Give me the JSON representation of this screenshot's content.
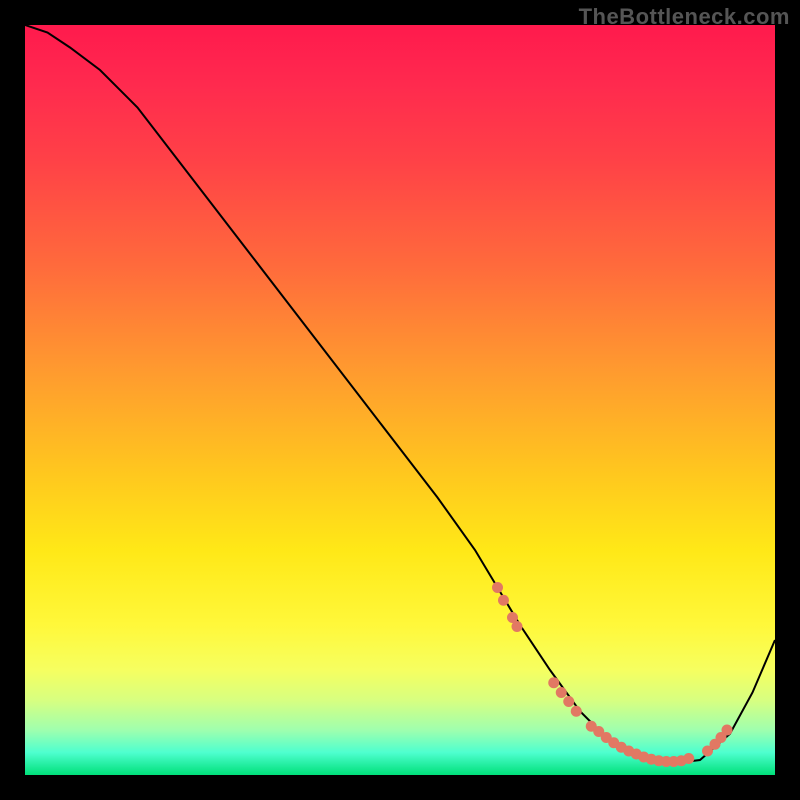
{
  "watermark": "TheBottleneck.com",
  "chart_data": {
    "type": "line",
    "title": "",
    "xlabel": "",
    "ylabel": "",
    "xlim": [
      0,
      100
    ],
    "ylim": [
      0,
      100
    ],
    "grid": false,
    "legend": false,
    "series": [
      {
        "name": "bottleneck-curve",
        "x": [
          0,
          3,
          6,
          10,
          15,
          20,
          25,
          30,
          35,
          40,
          45,
          50,
          55,
          60,
          63,
          66,
          70,
          74,
          78,
          82,
          86,
          90,
          94,
          97,
          100
        ],
        "y": [
          100,
          99,
          97,
          94,
          89,
          82.5,
          76,
          69.5,
          63,
          56.5,
          50,
          43.5,
          37,
          30,
          25,
          20,
          14,
          8.5,
          4.5,
          2.2,
          1.5,
          2.0,
          5.5,
          11,
          18
        ],
        "stroke": "#000000",
        "stroke_width": 2
      }
    ],
    "markers": {
      "name": "trough-markers",
      "color": "#e27863",
      "points": [
        {
          "x": 63.0,
          "y": 25.0
        },
        {
          "x": 63.8,
          "y": 23.3
        },
        {
          "x": 65.0,
          "y": 21.0
        },
        {
          "x": 65.6,
          "y": 19.8
        },
        {
          "x": 70.5,
          "y": 12.3
        },
        {
          "x": 71.5,
          "y": 11.0
        },
        {
          "x": 72.5,
          "y": 9.8
        },
        {
          "x": 73.5,
          "y": 8.5
        },
        {
          "x": 75.5,
          "y": 6.5
        },
        {
          "x": 76.5,
          "y": 5.8
        },
        {
          "x": 77.5,
          "y": 5.0
        },
        {
          "x": 78.5,
          "y": 4.3
        },
        {
          "x": 79.5,
          "y": 3.7
        },
        {
          "x": 80.5,
          "y": 3.2
        },
        {
          "x": 81.5,
          "y": 2.8
        },
        {
          "x": 82.5,
          "y": 2.4
        },
        {
          "x": 83.5,
          "y": 2.1
        },
        {
          "x": 84.5,
          "y": 1.9
        },
        {
          "x": 85.5,
          "y": 1.8
        },
        {
          "x": 86.5,
          "y": 1.8
        },
        {
          "x": 87.5,
          "y": 1.9
        },
        {
          "x": 88.5,
          "y": 2.2
        },
        {
          "x": 91.0,
          "y": 3.2
        },
        {
          "x": 92.0,
          "y": 4.1
        },
        {
          "x": 92.8,
          "y": 5.0
        },
        {
          "x": 93.6,
          "y": 6.0
        }
      ]
    }
  }
}
